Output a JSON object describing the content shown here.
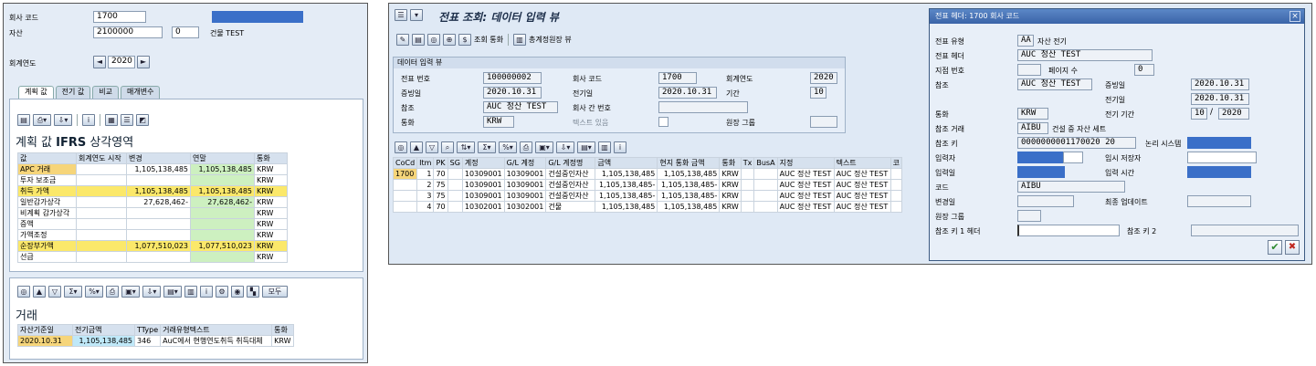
{
  "left": {
    "company_code_label": "회사 코드",
    "company_code_value": "1700",
    "asset_label": "자산",
    "asset_value": "2100000",
    "asset_sub_value": "0",
    "asset_desc": "건물 TEST",
    "fiscal_year_label": "회계연도",
    "fiscal_year_value": "2020",
    "prev_icon": "◄",
    "next_icon": "►",
    "tabs": [
      "계획 값",
      "전기 값",
      "비교",
      "매개변수"
    ],
    "section_title_prefix": "계획 값",
    "section_title_bold": "IFRS",
    "section_title_suffix": "상각영역",
    "values_headers": [
      "값",
      "회계연도 시작",
      "변경",
      "연말",
      "통화"
    ],
    "values_rows": [
      {
        "label": "APC 거래",
        "start": "",
        "change": "1,105,138,485",
        "end": "1,105,138,485",
        "cur": "KRW"
      },
      {
        "label": "투자 보조금",
        "start": "",
        "change": "",
        "end": "",
        "cur": "KRW"
      },
      {
        "label": "취득 가액",
        "start": "",
        "change": "1,105,138,485",
        "end": "1,105,138,485",
        "cur": "KRW"
      },
      {
        "label": "일반감가상각",
        "start": "",
        "change": "27,628,462-",
        "end": "27,628,462-",
        "cur": "KRW"
      },
      {
        "label": "비계획 감가상각",
        "start": "",
        "change": "",
        "end": "",
        "cur": "KRW"
      },
      {
        "label": "증액",
        "start": "",
        "change": "",
        "end": "",
        "cur": "KRW"
      },
      {
        "label": "가액조정",
        "start": "",
        "change": "",
        "end": "",
        "cur": "KRW"
      },
      {
        "label": "순장부가액",
        "start": "",
        "change": "1,077,510,023",
        "end": "1,077,510,023",
        "cur": "KRW"
      },
      {
        "label": "선급",
        "start": "",
        "change": "",
        "end": "",
        "cur": "KRW"
      }
    ],
    "trans_title": "거래",
    "trans_all_btn": "모두",
    "trans_headers": [
      "자산기준일",
      "전기금액",
      "TType",
      "거래유형텍스트",
      "통화"
    ],
    "trans_rows": [
      {
        "date": "2020.10.31",
        "amount": "1,105,138,485",
        "ttype": "346",
        "text": "AuC에서 현행연도취득 취득대체",
        "cur": "KRW"
      }
    ]
  },
  "right": {
    "title": "전표 조회: 데이터 입력 뷰",
    "toolbar_labels": {
      "currency": "조회 통화",
      "ledger": "총계정원장 뷰"
    },
    "group_title": "데이터 입력 뷰",
    "doc_no_label": "전표 번호",
    "doc_no": "100000002",
    "company_label": "회사 코드",
    "company": "1700",
    "fy_label": "회계연도",
    "fy": "2020",
    "doc_date_label": "증빙일",
    "doc_date": "2020.10.31",
    "post_date_label": "전기일",
    "post_date": "2020.10.31",
    "period_label": "기간",
    "period": "10",
    "ref_label": "참조",
    "ref": "AUC 정산 TEST",
    "cross_label": "회사 간 번호",
    "cross": "",
    "currency_label": "통화",
    "currency": "KRW",
    "text_exist_label": "텍스트 있음",
    "ledger_group_label": "원장 그룹",
    "grid_headers": [
      "CoCd",
      "Itm",
      "PK",
      "SG",
      "계정",
      "G/L 계정",
      "G/L 계정명",
      "금액",
      "현지 통화 금액",
      "통화",
      "Tx",
      "BusA",
      "지정",
      "텍스트",
      "코"
    ],
    "grid_rows": [
      {
        "cocd": "1700",
        "itm": "1",
        "pk": "70",
        "sg": "",
        "acct": "10309001",
        "gl": "10309001",
        "glname": "건설중인자산",
        "amt": "1,105,138,485",
        "lamt": "1,105,138,485",
        "cur": "KRW",
        "tx": "",
        "busa": "",
        "assign": "AUC 정산 TEST",
        "text": "AUC 정산 TEST"
      },
      {
        "cocd": "",
        "itm": "2",
        "pk": "75",
        "sg": "",
        "acct": "10309001",
        "gl": "10309001",
        "glname": "건설중인자산",
        "amt": "1,105,138,485-",
        "lamt": "1,105,138,485-",
        "cur": "KRW",
        "tx": "",
        "busa": "",
        "assign": "AUC 정산 TEST",
        "text": "AUC 정산 TEST"
      },
      {
        "cocd": "",
        "itm": "3",
        "pk": "75",
        "sg": "",
        "acct": "10309001",
        "gl": "10309001",
        "glname": "건설중인자산",
        "amt": "1,105,138,485-",
        "lamt": "1,105,138,485-",
        "cur": "KRW",
        "tx": "",
        "busa": "",
        "assign": "AUC 정산 TEST",
        "text": "AUC 정산 TEST"
      },
      {
        "cocd": "",
        "itm": "4",
        "pk": "70",
        "sg": "",
        "acct": "10302001",
        "gl": "10302001",
        "glname": "건물",
        "amt": "1,105,138,485",
        "lamt": "1,105,138,485",
        "cur": "KRW",
        "tx": "",
        "busa": "",
        "assign": "AUC 정산 TEST",
        "text": "AUC 정산 TEST"
      }
    ]
  },
  "dialog": {
    "title": "전표 헤더: 1700 회사 코드",
    "close": "×",
    "doc_type_label": "전표 유형",
    "doc_type": "AA",
    "doc_type_desc": "자산 전기",
    "header_label": "전표 헤더",
    "header": "AUC 정산 TEST",
    "branch_label": "지점 번호",
    "page_label": "페이지 수",
    "page": "0",
    "ref_label": "참조",
    "ref": "AUC 정산 TEST",
    "doc_date_label": "증빙일",
    "doc_date": "2020.10.31",
    "post_date_label": "전기일",
    "post_date": "2020.10.31",
    "cur_label": "통화",
    "cur": "KRW",
    "period_label": "전기 기간",
    "period": "10",
    "period_sep": "/",
    "period_year": "2020",
    "ref_tx_label": "참조 거래",
    "ref_tx": "AIBU",
    "ref_tx_desc": "건설 중 자산 세트",
    "ref_key_label": "참조 키",
    "ref_key": "0000000001170020 20",
    "logic_label": "논리 시스템",
    "entered_by_label": "입력자",
    "temp_saver_label": "임시 저장자",
    "entry_date_label": "입력일",
    "entry_time_label": "입력 시간",
    "tcode_label": "코드",
    "tcode": "AIBU",
    "changed_label": "변경일",
    "last_update_label": "최종 업데이트",
    "ledger_group_label": "원장 그룹",
    "ref_key1_label": "참조 키 1 헤더",
    "ref_key2_label": "참조 키 2",
    "ok_icon": "✔",
    "cancel_icon": "✖"
  },
  "colors": {
    "accent_blue": "#3a6fc8",
    "yellow": "#fbe86a",
    "green": "#cdf0c0",
    "panel_bg": "#dfe9f5"
  }
}
